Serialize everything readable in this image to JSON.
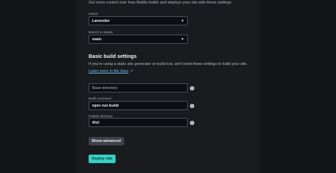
{
  "intro_text": "Get more control over how Netlify builds and deploys your site with these settings.",
  "owner": {
    "label": "Owner",
    "value": "Lavender"
  },
  "branch": {
    "label": "Branch to deploy",
    "value": "main"
  },
  "basic_build": {
    "title": "Basic build settings",
    "description": "If you're using a static site generator or build tool, we'll need these settings to build your site.",
    "learn_more": "Learn more in the docs",
    "learn_more_arrow": "↗"
  },
  "base_directory": {
    "placeholder": "Base directory",
    "value": ""
  },
  "build_command": {
    "label": "Build command",
    "value": "npm run build"
  },
  "publish_directory": {
    "label": "Publish directory",
    "value": "dist"
  },
  "buttons": {
    "show_advanced": "Show advanced",
    "deploy_site": "Deploy site"
  },
  "icons": {
    "select_chevron": "chevron-down-icon",
    "info": "info-icon"
  },
  "colors": {
    "background": "#0f1114",
    "panel": "#191b1f",
    "link": "#6ec5e8",
    "primary": "#35d2c4"
  }
}
